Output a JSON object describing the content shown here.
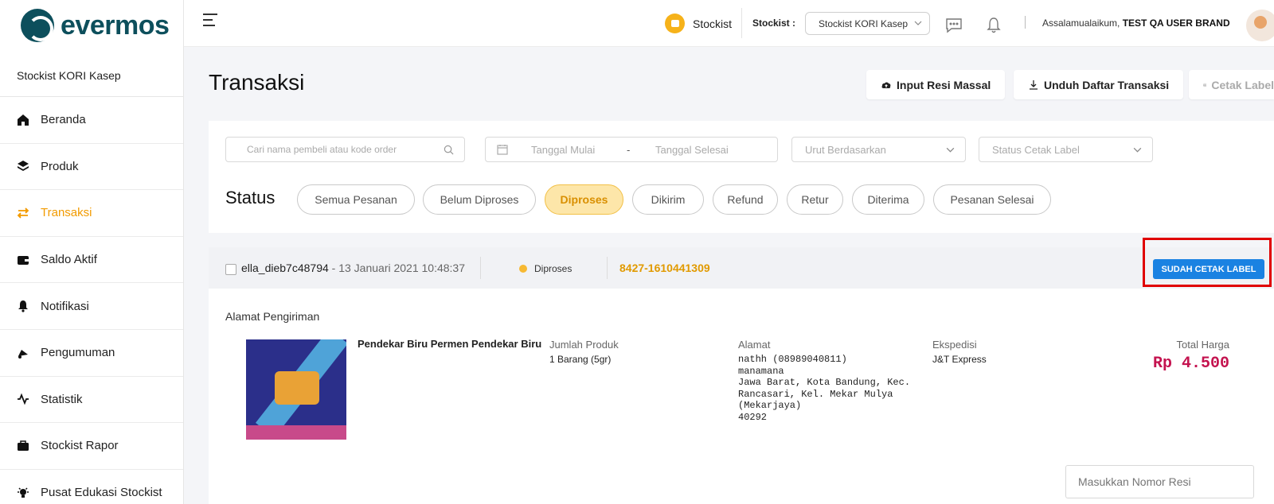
{
  "app": {
    "logo_text": "evermos",
    "store_name": "Stockist KORI Kasep"
  },
  "sidebar": {
    "items": [
      {
        "label": "Beranda",
        "icon": "home-icon"
      },
      {
        "label": "Produk",
        "icon": "layers-icon"
      },
      {
        "label": "Transaksi",
        "icon": "swap-icon",
        "active": true
      },
      {
        "label": "Saldo Aktif",
        "icon": "wallet-icon"
      },
      {
        "label": "Notifikasi",
        "icon": "bell-icon"
      },
      {
        "label": "Pengumuman",
        "icon": "megaphone-icon"
      },
      {
        "label": "Statistik",
        "icon": "activity-icon"
      },
      {
        "label": "Stockist Rapor",
        "icon": "briefcase-icon"
      },
      {
        "label": "Pusat Edukasi Stockist",
        "icon": "lightbulb-icon"
      }
    ]
  },
  "topbar": {
    "badge_label": "Stockist",
    "stockist_label": "Stockist :",
    "stockist_select": "Stockist KORI Kasep",
    "greeting_prefix": "Assalamualaikum, ",
    "user_name": "TEST QA USER BRAND"
  },
  "page": {
    "title": "Transaksi",
    "actions": {
      "input_resi": "Input Resi Massal",
      "unduh": "Unduh Daftar Transaksi",
      "cetak": "Cetak Label"
    }
  },
  "filters": {
    "search_placeholder": "Cari nama pembeli atau kode order",
    "date_start": "Tanggal Mulai",
    "date_sep": "-",
    "date_end": "Tanggal Selesai",
    "sort_placeholder": "Urut Berdasarkan",
    "label_status_placeholder": "Status Cetak Label"
  },
  "status": {
    "label": "Status",
    "tabs": [
      "Semua Pesanan",
      "Belum Diproses",
      "Diproses",
      "Dikirim",
      "Refund",
      "Retur",
      "Diterima",
      "Pesanan Selesai"
    ],
    "active": "Diproses"
  },
  "order": {
    "buyer": "ella_dieb7c48794",
    "date": " - 13 Januari 2021 10:48:37",
    "status": "Diproses",
    "code": "8427-1610441309",
    "label_button": "SUDAH CETAK LABEL",
    "address_title": "Alamat Pengiriman",
    "product_name": "Pendekar Biru Permen Pendekar Biru",
    "qty_label": "Jumlah Produk",
    "qty_value": "1 Barang (5gr)",
    "address_label": "Alamat",
    "address_lines": [
      "nathh (08989040811)",
      "manamana",
      "Jawa Barat, Kota Bandung, Kec.",
      "Rancasari, Kel. Mekar Mulya",
      "(Mekarjaya)",
      "40292"
    ],
    "courier_label": "Ekspedisi",
    "courier_value": "J&T Express",
    "total_label": "Total Harga",
    "total_value": "Rp 4.500",
    "resi_placeholder": "Masukkan Nomor Resi"
  },
  "colors": {
    "brand": "#0d4f5c",
    "accent": "#f29b00",
    "primary_button": "#1a82e2",
    "price": "#c4134f",
    "highlight": "#e00000"
  }
}
